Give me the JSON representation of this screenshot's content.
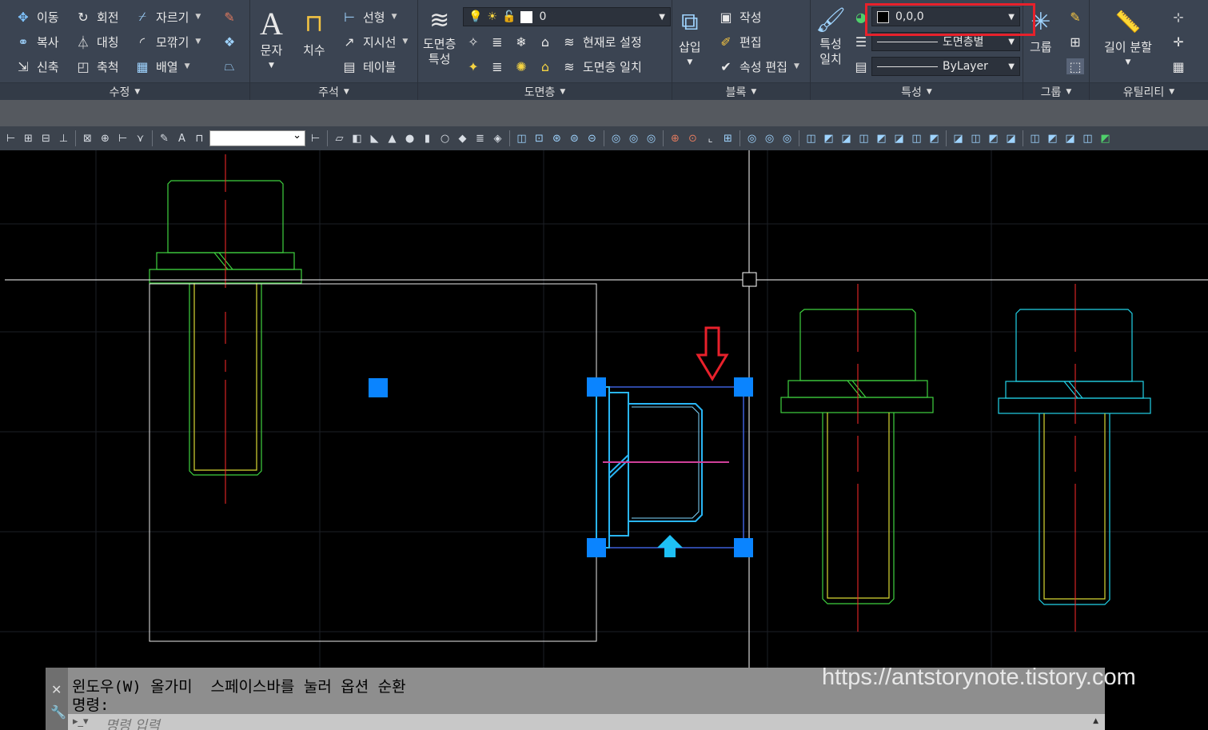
{
  "ribbon": {
    "modify": {
      "title": "수정",
      "move": "이동",
      "rotate": "회전",
      "trim": "자르기",
      "copy": "복사",
      "mirror": "대칭",
      "fillet": "모깎기",
      "stretch": "신축",
      "scale": "축척",
      "array": "배열"
    },
    "annotation": {
      "title": "주석",
      "text": "문자",
      "dimension": "치수",
      "linear": "선형",
      "leader": "지시선",
      "table": "테이블"
    },
    "layers": {
      "title": "도면층",
      "properties": "도면층\n특성",
      "current_layer": "0",
      "set_current": "현재로 설정",
      "match_layer": "도면층 일치"
    },
    "block": {
      "title": "블록",
      "insert": "삽입",
      "create": "작성",
      "edit": "편집",
      "edit_attributes": "속성 편집"
    },
    "properties": {
      "title": "특성",
      "match": "특성\n일치",
      "color_value": "0,0,0",
      "linetype_value": "도면층별",
      "lineweight_value": "ByLayer"
    },
    "groups": {
      "title": "그룹",
      "group": "그룹"
    },
    "utilities": {
      "title": "유틸리티",
      "measure": "길이 분할"
    }
  },
  "command": {
    "line1": "윈도우(W) 올가미  스페이스바를 눌러 옵션 순환",
    "line2": "명령:",
    "placeholder": "명령 입력"
  },
  "watermark": "https://antstorynote.tistory.com",
  "colors": {
    "green": "#3fd13f",
    "cyan": "#22d3e8",
    "red": "#ff2a2a",
    "grip": "#0a84ff",
    "highlight": "#e8212b",
    "ribbon": "#3b4452"
  }
}
